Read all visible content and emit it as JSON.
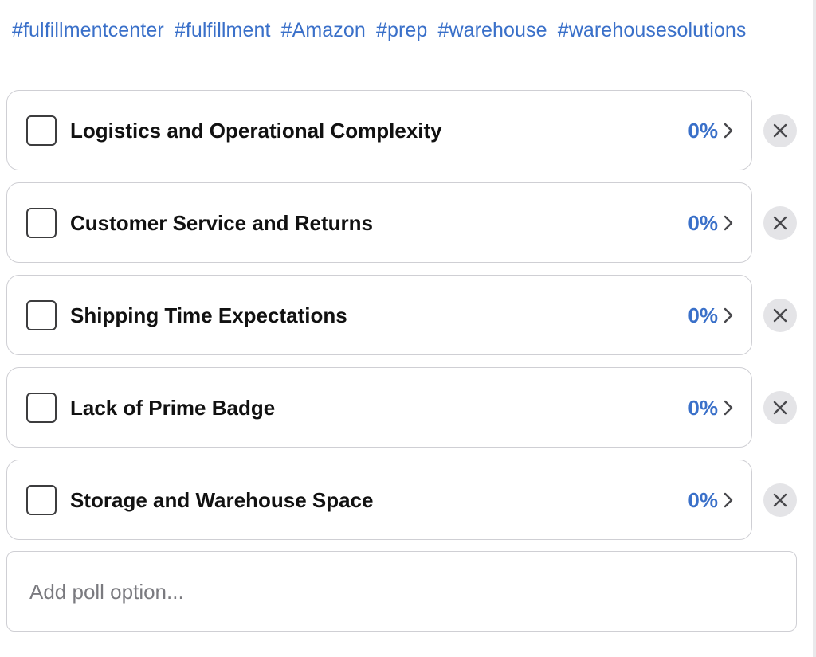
{
  "hashtags": [
    "#fulfillmentcenter",
    "#fulfillment",
    "#Amazon",
    "#prep",
    "#warehouse",
    "#warehousesolutions"
  ],
  "poll": {
    "options": [
      {
        "label": "Logistics and Operational Complexity",
        "percent": "0%"
      },
      {
        "label": "Customer Service and Returns",
        "percent": "0%"
      },
      {
        "label": "Shipping Time Expectations",
        "percent": "0%"
      },
      {
        "label": "Lack of Prime Badge",
        "percent": "0%"
      },
      {
        "label": "Storage and Warehouse Space",
        "percent": "0%"
      }
    ],
    "add_option_placeholder": "Add poll option...",
    "icons": {
      "checkbox": "checkbox-icon",
      "chevron": "chevron-right-icon",
      "remove": "close-icon"
    }
  },
  "colors": {
    "accent": "#3a70c9",
    "text": "#111111",
    "border": "#cfcfd4",
    "remove_bg": "#e4e4e7"
  }
}
